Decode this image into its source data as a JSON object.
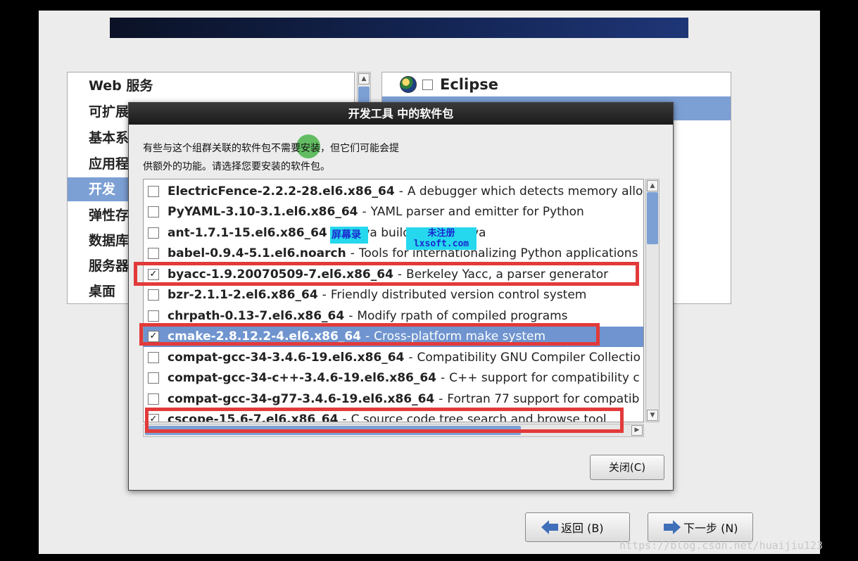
{
  "groups": {
    "items": [
      {
        "label": "Web 服务"
      },
      {
        "label": "可扩展"
      },
      {
        "label": "基本系统"
      },
      {
        "label": "应用程序"
      },
      {
        "label": "开发"
      },
      {
        "label": "弹性存储"
      },
      {
        "label": "数据库"
      },
      {
        "label": "服务器"
      },
      {
        "label": "桌面"
      }
    ],
    "selected": "开发"
  },
  "options": {
    "items": [
      {
        "label": "Eclipse",
        "checked": false,
        "icon": "globe-icon"
      }
    ]
  },
  "dialog": {
    "title": "开发工具 中的软件包",
    "description_line1": "有些与这个组群关联的软件包不需要安装，但它们可能会提",
    "description_line2": "供额外的功能。请选择您要安装的软件包。",
    "close_label": "关闭(C)",
    "packages": [
      {
        "name": "ElectricFence-2.2.2-28.el6.x86_64",
        "desc": "A debugger which detects memory allo",
        "checked": false
      },
      {
        "name": "PyYAML-3.10-3.1.el6.x86_64",
        "desc": "YAML parser and emitter for Python",
        "checked": false
      },
      {
        "name": "ant-1.7.1-15.el6.x86_64",
        "desc": "A Java build tool for java",
        "checked": false
      },
      {
        "name": "babel-0.9.4-5.1.el6.noarch",
        "desc": "Tools for internationalizing Python applications",
        "checked": false
      },
      {
        "name": "byacc-1.9.20070509-7.el6.x86_64",
        "desc": "Berkeley Yacc, a parser generator",
        "checked": true
      },
      {
        "name": "bzr-2.1.1-2.el6.x86_64",
        "desc": "Friendly distributed version control system",
        "checked": false
      },
      {
        "name": "chrpath-0.13-7.el6.x86_64",
        "desc": "Modify rpath of compiled programs",
        "checked": false
      },
      {
        "name": "cmake-2.8.12.2-4.el6.x86_64",
        "desc": "Cross-platform make system",
        "checked": true,
        "selected": true
      },
      {
        "name": "compat-gcc-34-3.4.6-19.el6.x86_64",
        "desc": "Compatibility GNU Compiler Collectio",
        "checked": false
      },
      {
        "name": "compat-gcc-34-c++-3.4.6-19.el6.x86_64",
        "desc": "C++ support for compatibility c",
        "checked": false
      },
      {
        "name": "compat-gcc-34-g77-3.4.6-19.el6.x86_64",
        "desc": "Fortran 77 support for compatib",
        "checked": false
      },
      {
        "name": "cscope-15.6-7.el6.x86_64",
        "desc": "C source code tree search and browse tool",
        "checked": true
      }
    ],
    "separator": "-"
  },
  "watermark": {
    "line_a": "屏幕录",
    "line_b": "未注册",
    "line_c": "lxsoft.com"
  },
  "nav": {
    "back_label": "返回 (B)",
    "next_label": "下一步 (N)"
  },
  "url_watermark": "https://blog.csdn.net/huaijiu123",
  "colors": {
    "highlight": "#e23a3a",
    "selection": "#7c9fd4"
  }
}
